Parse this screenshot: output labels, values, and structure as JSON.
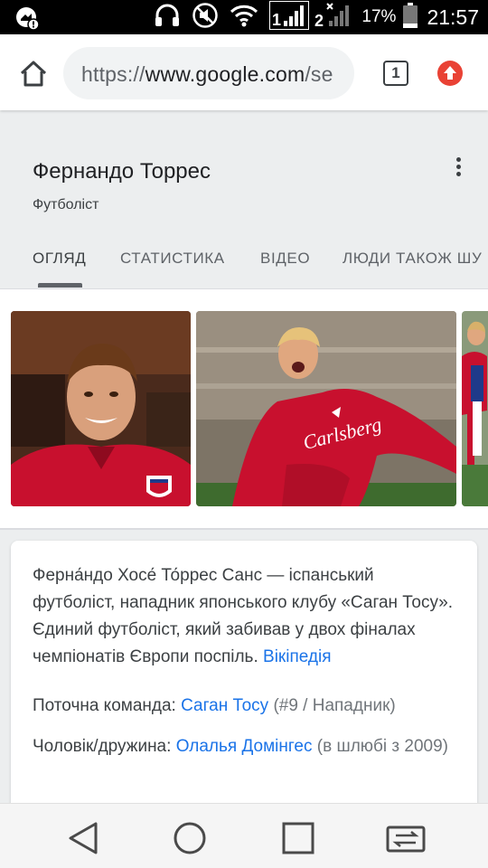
{
  "status_bar": {
    "battery": "17%",
    "time": "21:57",
    "sim1": "1",
    "sim2": "2"
  },
  "browser": {
    "url_scheme": "https://",
    "url_host": "www.google.com",
    "url_rest": "/se",
    "tab_count": "1"
  },
  "knowledge_panel": {
    "title": "Фернандо Торрес",
    "subtitle": "Футболіст",
    "tabs": [
      {
        "label": "ОГЛЯД",
        "active": true
      },
      {
        "label": "СТАТИСТИКА",
        "active": false
      },
      {
        "label": "ВІДЕО",
        "active": false
      },
      {
        "label": "ЛЮДИ ТАКОЖ ШУ",
        "active": false
      }
    ]
  },
  "description": {
    "text": "Ферна́ндо Хосе́ То́ррес Санс — іспанський футболіст, нападник японського клубу «Саган Тосу». Єдиний футболіст, який забивав у двох фіналах чемпіонатів Європи поспіль.",
    "source_link": "Вікіпедія"
  },
  "facts": [
    {
      "label": "Поточна команда:",
      "link": "Саган Тосу",
      "extra": "(#9 / Нападник)"
    },
    {
      "label": "Чоловік/дружина:",
      "link": "Олалья Домінгес",
      "extra": "(в шлюбі з 2009)"
    }
  ],
  "colors": {
    "link": "#1a73e8",
    "liverpool_red": "#c8102e",
    "update_badge": "#e94235"
  }
}
